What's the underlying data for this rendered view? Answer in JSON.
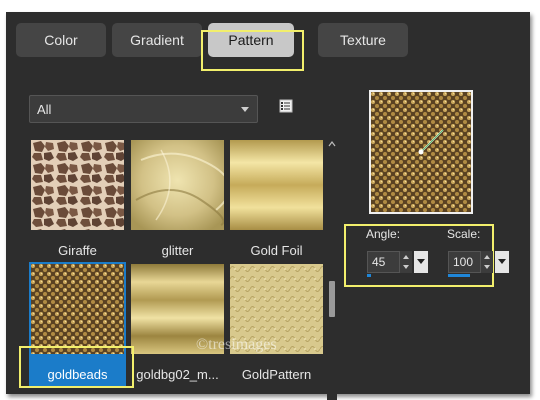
{
  "tabs": [
    {
      "label": "Color",
      "active": false
    },
    {
      "label": "Gradient",
      "active": false
    },
    {
      "label": "Pattern",
      "active": true
    },
    {
      "label": "Texture",
      "active": false
    }
  ],
  "category_filter": {
    "selected": "All"
  },
  "patterns": [
    {
      "label": "Giraffe",
      "selected": false
    },
    {
      "label": "glitter",
      "selected": false
    },
    {
      "label": "Gold Foil",
      "selected": false
    },
    {
      "label": "goldbeads",
      "selected": true
    },
    {
      "label": "goldbg02_m...",
      "selected": false
    },
    {
      "label": "GoldPattern",
      "selected": false
    }
  ],
  "angle": {
    "label": "Angle:",
    "value": "45",
    "fraction": 0.06
  },
  "scale": {
    "label": "Scale:",
    "value": "100",
    "fraction": 0.45
  },
  "watermark": "©tresimages",
  "colors": {
    "accent": "#1f86d8",
    "highlight": "#f2ef6c",
    "panel": "#2d2d2d"
  }
}
